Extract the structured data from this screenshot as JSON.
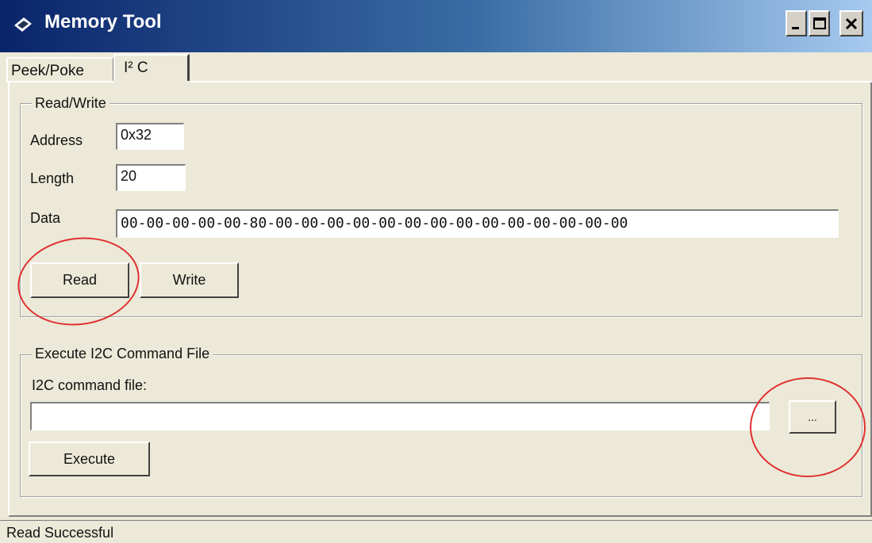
{
  "window": {
    "title": "Memory Tool",
    "icon": "chip-icon",
    "controls": [
      "minimize-icon",
      "maximize-icon",
      "close-icon"
    ]
  },
  "tabs": [
    {
      "label": "Peek/Poke",
      "selected": false
    },
    {
      "label": "I² C",
      "selected": true
    }
  ],
  "read_write": {
    "legend": "Read/Write",
    "address_label": "Address",
    "address_value": "0x32",
    "length_label": "Length",
    "length_value": "20",
    "data_label": "Data",
    "data_value": "00-00-00-00-00-80-00-00-00-00-00-00-00-00-00-00-00-00-00-00",
    "read_button": "Read",
    "write_button": "Write"
  },
  "execute": {
    "legend": "Execute I2C Command File",
    "file_label": "I2C command file:",
    "file_value": "",
    "browse_button": "...",
    "execute_button": "Execute"
  },
  "status": "Read Successful",
  "colors": {
    "face": "#ece9d8",
    "titlebar_start": "#0a246a",
    "titlebar_end": "#a6caf0",
    "annotation": "#e03030"
  }
}
